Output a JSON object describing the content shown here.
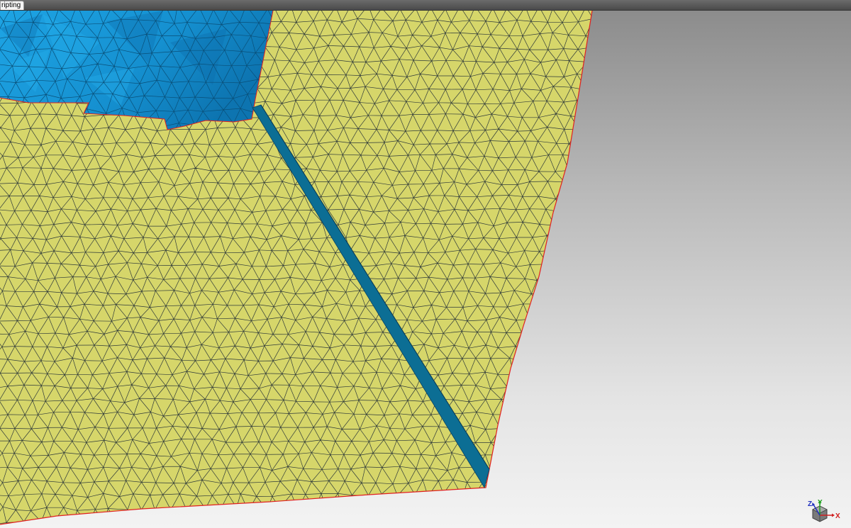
{
  "tab": {
    "label": "ripting"
  },
  "viewport": {
    "background_top": "#8c8c8c",
    "background_bottom": "#f3f3f3",
    "mesh_fill": "#d6d66a",
    "mesh_edge": "#2f3a3a",
    "boundary_edge": "#e02020",
    "fracture_fill": "#0c6e94",
    "blue_surface_fill": "#1590d0"
  },
  "triad": {
    "x_label": "X",
    "y_label": "Y",
    "z_label": "Z",
    "x_color": "#d02020",
    "y_color": "#20a020",
    "z_color": "#2030c0"
  }
}
